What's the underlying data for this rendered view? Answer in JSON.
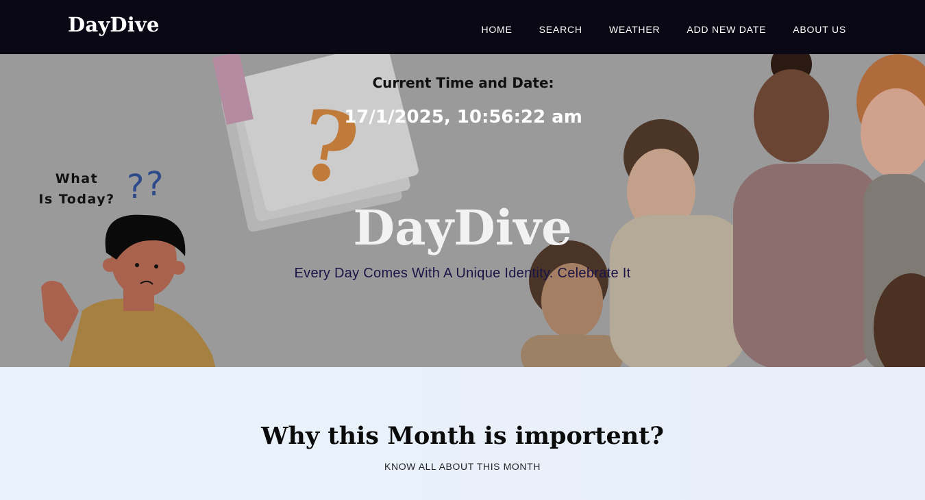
{
  "navbar": {
    "brand": "DayDive",
    "links": [
      "HOME",
      "SEARCH",
      "WEATHER",
      "ADD NEW DATE",
      "ABOUT US"
    ]
  },
  "hero": {
    "what_line1": "What",
    "what_line2": "Is Today?",
    "time_label": "Current Time and Date:",
    "time_value": "17/1/2025, 10:56:22 am",
    "title": "DayDive",
    "tagline": "Every Day Comes With A Unique Identity. Celebrate It"
  },
  "section": {
    "title": "Why this Month is importent?",
    "subtitle": "KNOW ALL ABOUT THIS MONTH"
  },
  "icons": {
    "calendar": "calendar-question-icon",
    "question_marks": "question-marks-icon",
    "boy": "confused-boy-illustration",
    "people": "people-photo"
  },
  "colors": {
    "navbar_bg": "#0a0814",
    "hero_overlay": "#9a9a9a",
    "tagline": "#1b1446",
    "question_accent": "#c07a3a"
  }
}
